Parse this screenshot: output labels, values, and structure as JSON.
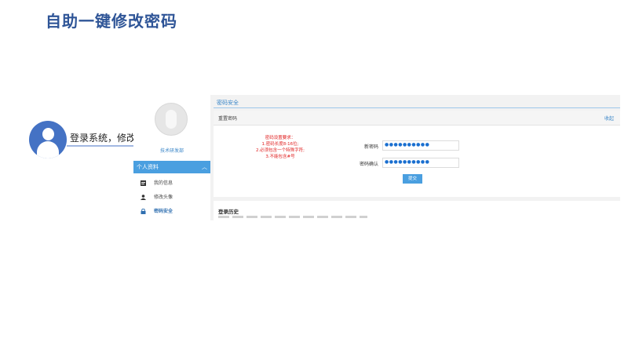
{
  "slide": {
    "title": "自助一键修改密码",
    "annotation": "登录系统，修改密码"
  },
  "sidebar": {
    "username": "技术研发部",
    "section_header": "个人资料",
    "items": [
      {
        "label": "我的信息",
        "icon": "profile-card-icon",
        "active": false
      },
      {
        "label": "修改头像",
        "icon": "user-icon",
        "active": false
      },
      {
        "label": "密码安全",
        "icon": "lock-icon",
        "active": true
      }
    ]
  },
  "main": {
    "tab_title": "密码安全",
    "panel_title": "重置密码",
    "panel_action": "收起",
    "requirements": [
      "密码设置要求：",
      "1.密码长度8-16位;",
      "2.必须包含一个特殊字符;",
      "3.不能包含#号"
    ],
    "fields": [
      {
        "label": "新密码",
        "value": "●●●●●●●●●●"
      },
      {
        "label": "密码确认",
        "value": "●●●●●●●●●●"
      }
    ],
    "submit_label": "提交",
    "history_title": "登录历史"
  },
  "colors": {
    "title": "#2f5597",
    "accent": "#4a9fe0",
    "requirement_text": "#e02020",
    "avatar_bg": "#4472c4"
  }
}
